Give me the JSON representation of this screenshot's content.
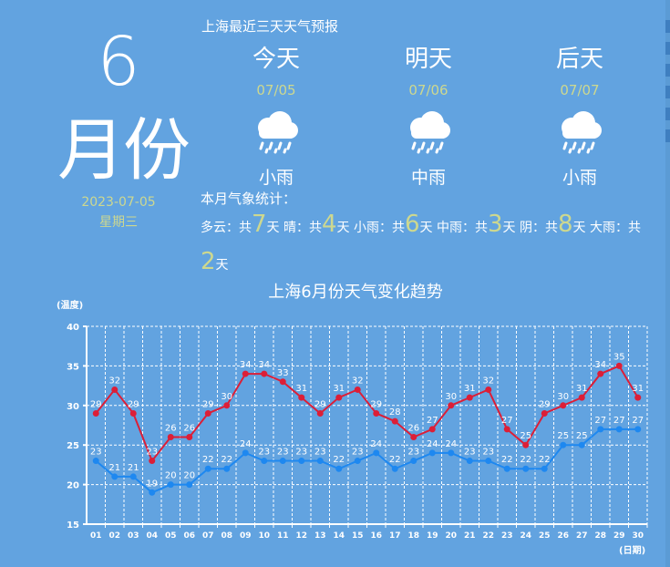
{
  "header": {
    "month_num": "6",
    "month_word": "月份",
    "date": "2023-07-05",
    "weekday": "星期三"
  },
  "forecast": {
    "title": "上海最近三天天气预报",
    "days": [
      {
        "name": "今天",
        "date": "07/05",
        "condition": "小雨",
        "icon": "rain-cloud-icon"
      },
      {
        "name": "明天",
        "date": "07/06",
        "condition": "中雨",
        "icon": "rain-cloud-icon"
      },
      {
        "name": "后天",
        "date": "07/07",
        "condition": "小雨",
        "icon": "rain-cloud-icon"
      }
    ]
  },
  "stats": {
    "title": "本月气象统计：",
    "items": [
      {
        "label": "多云：共",
        "count": "7",
        "unit": "天"
      },
      {
        "label": "晴：共",
        "count": "4",
        "unit": "天"
      },
      {
        "label": "小雨：共",
        "count": "6",
        "unit": "天"
      },
      {
        "label": "中雨：共",
        "count": "3",
        "unit": "天"
      },
      {
        "label": "阴：共",
        "count": "8",
        "unit": "天"
      },
      {
        "label": "大雨：共",
        "count": "2",
        "unit": "天"
      }
    ]
  },
  "colors": {
    "background": "#62a3e0",
    "high_line": "#dc1e37",
    "low_line": "#1e88f0",
    "accent_text": "#cdd88f"
  },
  "chart_data": {
    "type": "line",
    "title": "上海6月份天气变化趋势",
    "ylabel": "(温度)",
    "xlabel": "(日期)",
    "ylim": [
      15,
      40
    ],
    "yticks": [
      15,
      20,
      25,
      30,
      35,
      40
    ],
    "grid": true,
    "categories": [
      "01",
      "02",
      "03",
      "04",
      "05",
      "06",
      "07",
      "08",
      "09",
      "10",
      "11",
      "12",
      "13",
      "14",
      "15",
      "16",
      "17",
      "18",
      "19",
      "20",
      "21",
      "22",
      "23",
      "24",
      "25",
      "26",
      "27",
      "28",
      "29",
      "30"
    ],
    "series": [
      {
        "values": [
          29,
          32,
          29,
          23,
          26,
          26,
          29,
          30,
          34,
          34,
          33,
          31,
          29,
          31,
          32,
          29,
          28,
          26,
          27,
          30,
          31,
          32,
          27,
          25,
          29,
          30,
          31,
          34,
          35,
          31
        ],
        "color": "#dc1e37"
      },
      {
        "values": [
          23,
          21,
          21,
          19,
          20,
          20,
          22,
          22,
          24,
          23,
          23,
          23,
          23,
          22,
          23,
          24,
          22,
          23,
          24,
          24,
          23,
          23,
          22,
          22,
          22,
          25,
          25,
          27,
          27,
          27
        ],
        "color": "#1e88f0"
      }
    ]
  }
}
